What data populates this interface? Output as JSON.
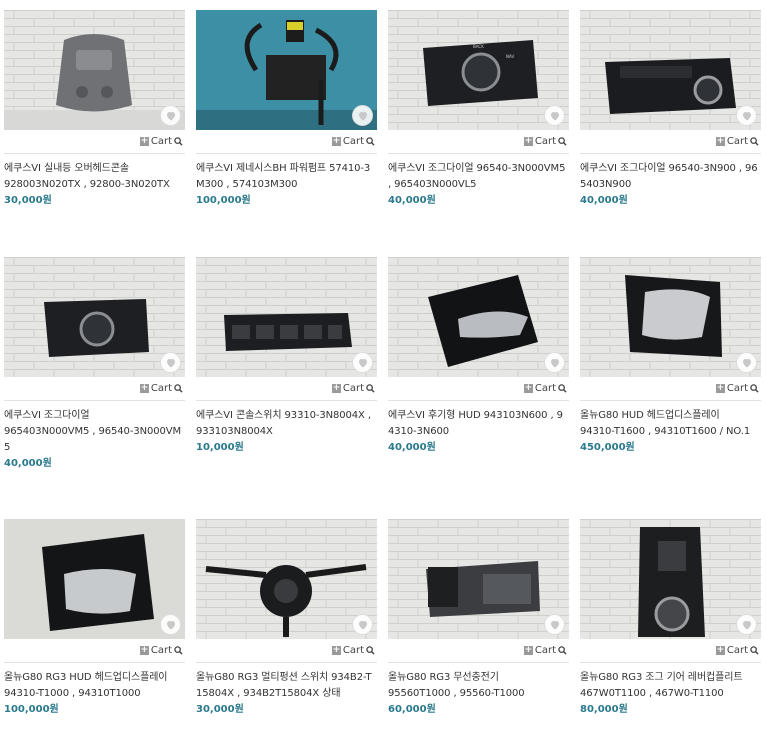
{
  "products": [
    {
      "title": "에쿠스VI 실내등 오버헤드콘솔",
      "codes": "928003N020TX , 92800-3N020TX",
      "price": "30,000원",
      "cart_label": "Cart"
    },
    {
      "title": "에쿠스VI 제네시스BH 파워펌프 57410-3M300 , 574103M300",
      "codes": "",
      "price": "100,000원",
      "cart_label": "Cart"
    },
    {
      "title": "에쿠스VI 조그다이얼 96540-3N000VM5 , 965403N000VL5",
      "codes": "",
      "price": "40,000원",
      "cart_label": "Cart"
    },
    {
      "title": "에쿠스VI 조그다이얼 96540-3N900 , 965403N900",
      "codes": "",
      "price": "40,000원",
      "cart_label": "Cart"
    },
    {
      "title": "에쿠스VI 조그다이얼",
      "codes": "965403N000VM5 , 96540-3N000VM5",
      "price": "40,000원",
      "cart_label": "Cart"
    },
    {
      "title": "에쿠스VI 콘솔스위치 93310-3N8004X , 933103N8004X",
      "codes": "",
      "price": "10,000원",
      "cart_label": "Cart"
    },
    {
      "title": "에쿠스VI 후기형 HUD 943103N600 , 94310-3N600",
      "codes": "",
      "price": "40,000원",
      "cart_label": "Cart"
    },
    {
      "title": "올뉴G80 HUD 헤드업디스플레이",
      "codes": "94310-T1600 , 94310T1600 / NO.1",
      "price": "450,000원",
      "cart_label": "Cart"
    },
    {
      "title": "올뉴G80 RG3 HUD 헤드업디스플레이",
      "codes": "94310-T1000 , 94310T1000",
      "price": "100,000원",
      "cart_label": "Cart"
    },
    {
      "title": "올뉴G80 RG3 멀티펑션 스위치 934B2-T15804X , 934B2T15804X 상태",
      "codes": "",
      "price": "30,000원",
      "cart_label": "Cart"
    },
    {
      "title": "올뉴G80 RG3 무선충전기",
      "codes": "95560T1000 , 95560-T1000",
      "price": "60,000원",
      "cart_label": "Cart"
    },
    {
      "title": "올뉴G80 RG3 조그 기어 레버컵플리트",
      "codes": "467W0T1100 , 467W0-T1100",
      "price": "80,000원",
      "cart_label": "Cart"
    }
  ],
  "colors": {
    "price": "#2a7a8e",
    "heart": "#c8c8c8",
    "divider": "#e2e2e2"
  },
  "icons": {
    "wishlist": "heart-icon",
    "add": "plus-icon",
    "zoom": "magnifier-icon"
  }
}
